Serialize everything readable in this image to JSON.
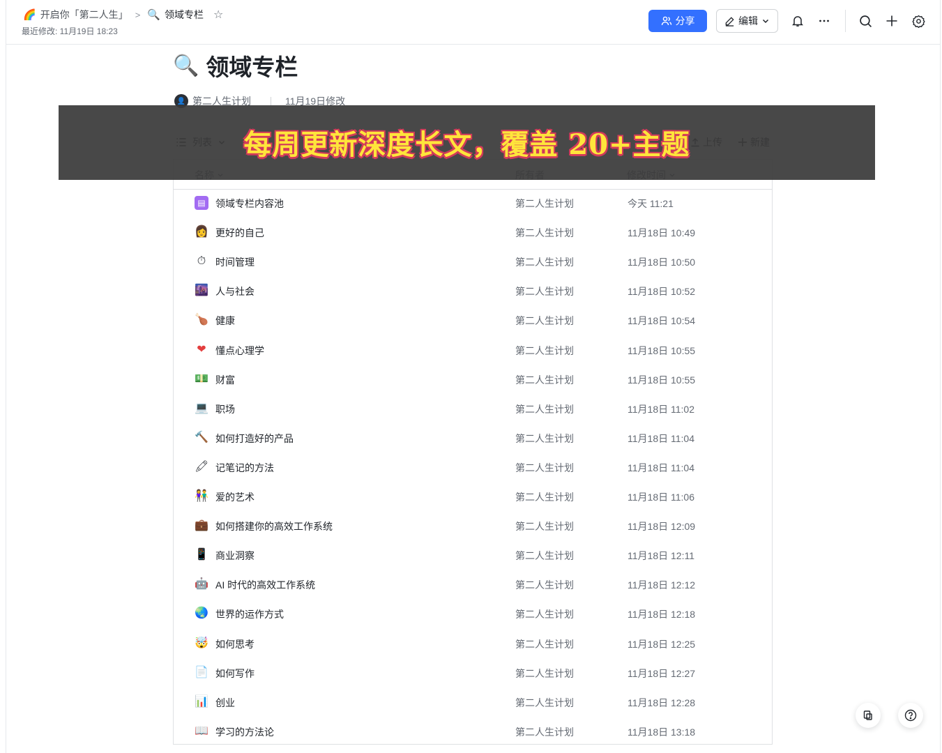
{
  "header": {
    "crumb_root_emoji": "🌈",
    "crumb_root": "开启你「第二人生」",
    "crumb_sep": ">",
    "crumb_current_emoji": "🔍",
    "crumb_current": "领域专栏",
    "last_modified": "最近修改: 11月19日 18:23",
    "share_label": "分享",
    "edit_label": "编辑",
    "accent": "#3370ff"
  },
  "page": {
    "title_emoji": "🔍",
    "title": "领域专栏",
    "owner": "第二人生计划",
    "modified": "11月19日修改"
  },
  "toolbar": {
    "view_label": "列表",
    "upload_label": "上传",
    "new_label": "新建"
  },
  "table": {
    "columns": [
      "名称",
      "所有者",
      "修改时间"
    ],
    "rows": [
      {
        "icon": "▤",
        "name": "领域专栏内容池",
        "owner": "第二人生计划",
        "time": "今天 11:21"
      },
      {
        "icon": "👩",
        "name": "更好的自己",
        "owner": "第二人生计划",
        "time": "11月18日 10:49"
      },
      {
        "icon": "⏱",
        "name": "时间管理",
        "owner": "第二人生计划",
        "time": "11月18日 10:50"
      },
      {
        "icon": "🌆",
        "name": "人与社会",
        "owner": "第二人生计划",
        "time": "11月18日 10:52"
      },
      {
        "icon": "🍗",
        "name": "健康",
        "owner": "第二人生计划",
        "time": "11月18日 10:54"
      },
      {
        "icon": "❤",
        "name": "懂点心理学",
        "owner": "第二人生计划",
        "time": "11月18日 10:55"
      },
      {
        "icon": "💵",
        "name": "财富",
        "owner": "第二人生计划",
        "time": "11月18日 10:55"
      },
      {
        "icon": "💻",
        "name": "职场",
        "owner": "第二人生计划",
        "time": "11月18日 11:02"
      },
      {
        "icon": "🔨",
        "name": "如何打造好的产品",
        "owner": "第二人生计划",
        "time": "11月18日 11:04"
      },
      {
        "icon": "🖍",
        "name": "记笔记的方法",
        "owner": "第二人生计划",
        "time": "11月18日 11:04"
      },
      {
        "icon": "👫",
        "name": "爱的艺术",
        "owner": "第二人生计划",
        "time": "11月18日 11:06"
      },
      {
        "icon": "💼",
        "name": "如何搭建你的高效工作系统",
        "owner": "第二人生计划",
        "time": "11月18日 12:09"
      },
      {
        "icon": "📱",
        "name": "商业洞察",
        "owner": "第二人生计划",
        "time": "11月18日 12:11"
      },
      {
        "icon": "🤖",
        "name": "AI 时代的高效工作系统",
        "owner": "第二人生计划",
        "time": "11月18日 12:12"
      },
      {
        "icon": "🌏",
        "name": "世界的运作方式",
        "owner": "第二人生计划",
        "time": "11月18日 12:18"
      },
      {
        "icon": "🤯",
        "name": "如何思考",
        "owner": "第二人生计划",
        "time": "11月18日 12:25"
      },
      {
        "icon": "📄",
        "name": "如何写作",
        "owner": "第二人生计划",
        "time": "11月18日 12:27"
      },
      {
        "icon": "📊",
        "name": "创业",
        "owner": "第二人生计划",
        "time": "11月18日 12:28"
      },
      {
        "icon": "📖",
        "name": "学习的方法论",
        "owner": "第二人生计划",
        "time": "11月18日 13:18"
      }
    ]
  },
  "banner": {
    "text": "每周更新深度长文，覆盖 20+主题",
    "text_color": "#ffe53b",
    "stroke_color": "#d23a5a"
  }
}
